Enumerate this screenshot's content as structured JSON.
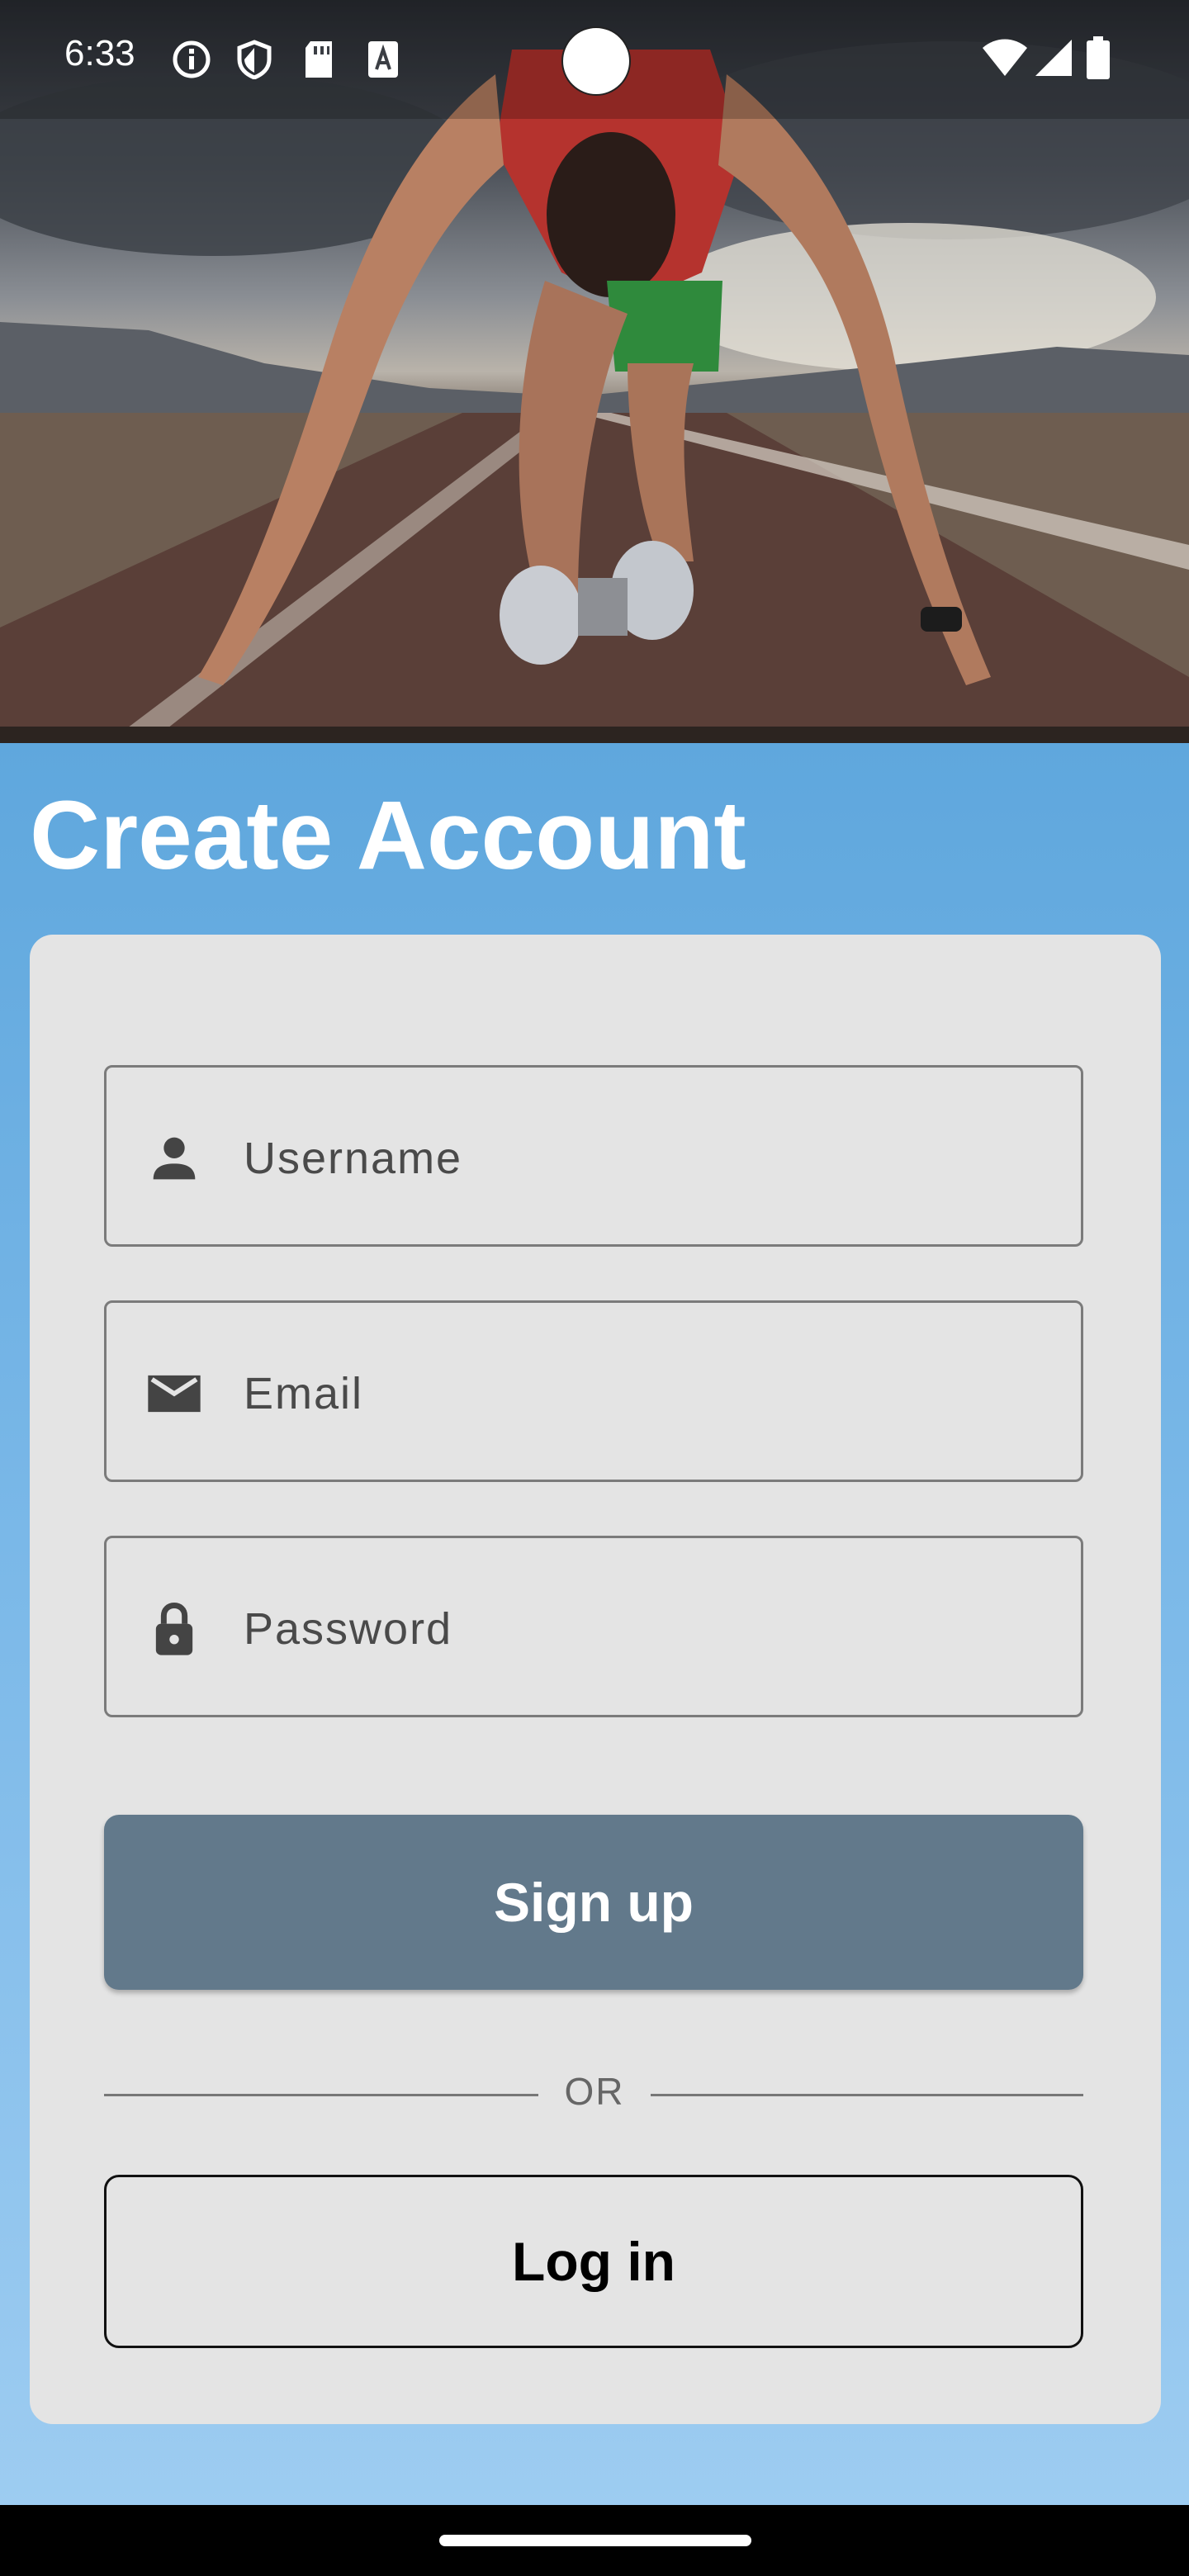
{
  "status_bar": {
    "time": "6:33",
    "left_icons": [
      "info-icon",
      "shield-icon",
      "sd-card-icon",
      "text-a-icon"
    ],
    "right_icons": [
      "wifi-icon",
      "signal-icon",
      "battery-icon"
    ]
  },
  "hero": {
    "image_label": "sprinter"
  },
  "page": {
    "title": "Create Account"
  },
  "form": {
    "username": {
      "placeholder": "Username",
      "value": "",
      "icon": "person-icon"
    },
    "email": {
      "placeholder": "Email",
      "value": "",
      "icon": "mail-icon"
    },
    "password": {
      "placeholder": "Password",
      "value": "",
      "icon": "lock-icon"
    },
    "signup_label": "Sign up",
    "divider_label": "OR",
    "login_label": "Log in"
  },
  "colors": {
    "panel_top": "#5fa7dd",
    "panel_bottom": "#9dccf1",
    "card": "#e4e4e4",
    "signup_button": "#62798b"
  }
}
